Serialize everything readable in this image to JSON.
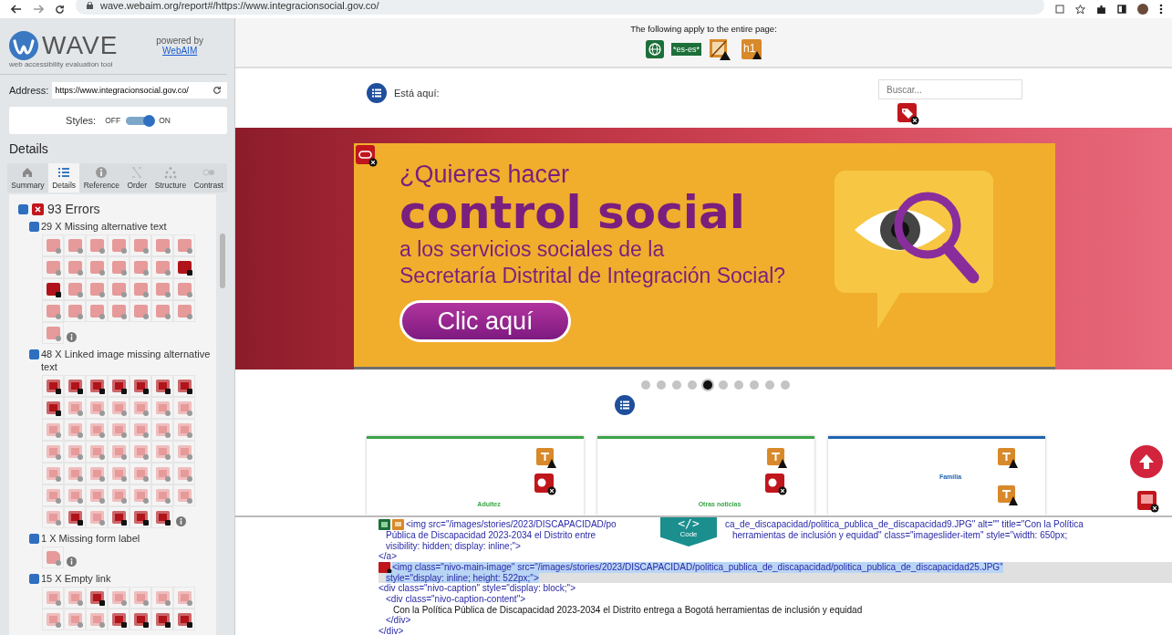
{
  "browser": {
    "url": "wave.webaim.org/report#/https://www.integracionsocial.gov.co/"
  },
  "sidebar": {
    "logo_text": "WAVE",
    "tagline": "web accessibility evaluation tool",
    "powered_by": "powered by",
    "powered_link": "WebAIM",
    "address": {
      "label": "Address:",
      "value": "https://www.integracionsocial.gov.co/"
    },
    "styles": {
      "label": "Styles:",
      "off_label": "OFF",
      "on_label": "ON",
      "on": true
    },
    "heading": "Details",
    "tabs": [
      {
        "label": "Summary",
        "selected": false
      },
      {
        "label": "Details",
        "selected": true
      },
      {
        "label": "Reference",
        "selected": false
      },
      {
        "label": "Order",
        "selected": false
      },
      {
        "label": "Structure",
        "selected": false
      },
      {
        "label": "Contrast",
        "selected": false
      }
    ],
    "errors": {
      "label": "93 Errors",
      "checked": true,
      "groups": [
        {
          "label": "29 X Missing alternative text",
          "checked": true,
          "kind": "image",
          "info": true,
          "highlighted": [
            false,
            false,
            false,
            false,
            false,
            false,
            false,
            false,
            false,
            false,
            false,
            false,
            false,
            true,
            true,
            false,
            false,
            false,
            false,
            false,
            false,
            false,
            false,
            false,
            false,
            false,
            false,
            false,
            false
          ]
        },
        {
          "label": "48 X Linked image missing alternative text",
          "checked": true,
          "kind": "linked-image",
          "info": true,
          "highlighted": [
            true,
            true,
            true,
            true,
            true,
            true,
            true,
            true,
            false,
            false,
            false,
            false,
            false,
            false,
            false,
            false,
            false,
            false,
            false,
            false,
            false,
            false,
            false,
            false,
            false,
            false,
            false,
            false,
            false,
            false,
            false,
            false,
            false,
            false,
            false,
            false,
            false,
            false,
            false,
            false,
            false,
            false,
            false,
            true,
            false,
            true,
            true,
            true
          ]
        },
        {
          "label": "1 X Missing form label",
          "checked": true,
          "kind": "form-label",
          "info": true,
          "highlighted": [
            false
          ]
        },
        {
          "label": "15 X Empty link",
          "checked": true,
          "kind": "link",
          "info": false,
          "highlighted": [
            false,
            false,
            true,
            false,
            false,
            false,
            false,
            false,
            false,
            false,
            true,
            true,
            true,
            true
          ]
        }
      ]
    }
  },
  "page_bar": {
    "text": "The following apply to the entire page:",
    "icons": [
      {
        "kind": "language"
      },
      {
        "kind": "lang-badge",
        "label": "*es-es*"
      },
      {
        "kind": "no-title"
      },
      {
        "kind": "heading",
        "label": "h1"
      }
    ]
  },
  "site": {
    "breadcrumb": "Está aquí:",
    "search_placeholder": "Buscar...",
    "banner": {
      "line_1": "¿Quieres hacer",
      "line_2": "control social",
      "line_3": "a los servicios sociales de la",
      "line_4": "Secretaría Distrital de Integración Social?",
      "button": "Clic aquí"
    },
    "slider_dots": [
      {
        "selected": false
      },
      {
        "selected": false
      },
      {
        "selected": false
      },
      {
        "selected": false
      },
      {
        "selected": true
      },
      {
        "selected": false
      },
      {
        "selected": false
      },
      {
        "selected": false
      },
      {
        "selected": false
      },
      {
        "selected": false
      }
    ],
    "cards": [
      {
        "color": "#3aa548",
        "items": [
          {
            "kind": "text-warning"
          },
          {
            "kind": "media-error"
          },
          {
            "kind": "label",
            "text": "Adultez"
          }
        ]
      },
      {
        "color": "#3aa548",
        "items": [
          {
            "kind": "text-warning"
          },
          {
            "kind": "media-error"
          },
          {
            "kind": "label",
            "text": "Otras noticias"
          }
        ]
      },
      {
        "color": "#1f64b0",
        "items": [
          {
            "kind": "text-warning"
          },
          {
            "kind": "label",
            "text": "Familia"
          },
          {
            "kind": "text-warning"
          }
        ]
      }
    ]
  },
  "code": {
    "tab_icon": "</>",
    "tab_label": "Code",
    "lines": [
      {
        "kind": "markup",
        "highlighted": false,
        "markers": [
          {
            "kind": "feature"
          },
          {
            "kind": "alert"
          }
        ],
        "lines": [
          [
            "<img src=\"/images/stories/2023/DISCAPACIDAD/po",
            "ca_de_discapacidad/politica_publica_de_discapacidad9.JPG\" alt=\"\" title=\"Con la Política"
          ],
          [
            "Pública de Discapacidad 2023-2034 el Distrito entre",
            "herramientas de inclusión y equidad\" class=\"imageslider-item\" style=\"width: 650px;"
          ],
          [
            "visibility: hidden; display: inline;\">"
          ]
        ]
      },
      {
        "kind": "markup",
        "highlighted": false,
        "lines": [
          [
            "</a>"
          ]
        ]
      },
      {
        "kind": "markup",
        "highlighted": true,
        "markers": [
          {
            "kind": "error"
          }
        ],
        "lines": [
          [
            "<img class=\"nivo-main-image\" src=\"/images/stories/2023/DISCAPACIDAD/politica_publica_de_discapacidad/politica_publica_de_discapacidad25.JPG\""
          ],
          [
            "style=\"display: inline; height: 522px;\">"
          ]
        ]
      },
      {
        "kind": "markup",
        "highlighted": false,
        "lines": [
          [
            "<div class=\"nivo-caption\" style=\"display: block;\">"
          ]
        ],
        "children": [
          {
            "kind": "markup",
            "highlighted": false,
            "lines": [
              [
                "<div class=\"nivo-caption-content\">"
              ]
            ],
            "children": [
              {
                "kind": "text",
                "highlighted": false,
                "lines": [
                  [
                    "Con la Política Pública de Discapacidad 2023-2034 el Distrito entrega a Bogotá herramientas de inclusión y equidad"
                  ]
                ]
              }
            ]
          },
          {
            "kind": "markup",
            "highlighted": false,
            "lines": [
              [
                "</div>"
              ]
            ]
          }
        ]
      },
      {
        "kind": "markup",
        "highlighted": false,
        "lines": [
          [
            "</div>"
          ]
        ]
      }
    ]
  }
}
